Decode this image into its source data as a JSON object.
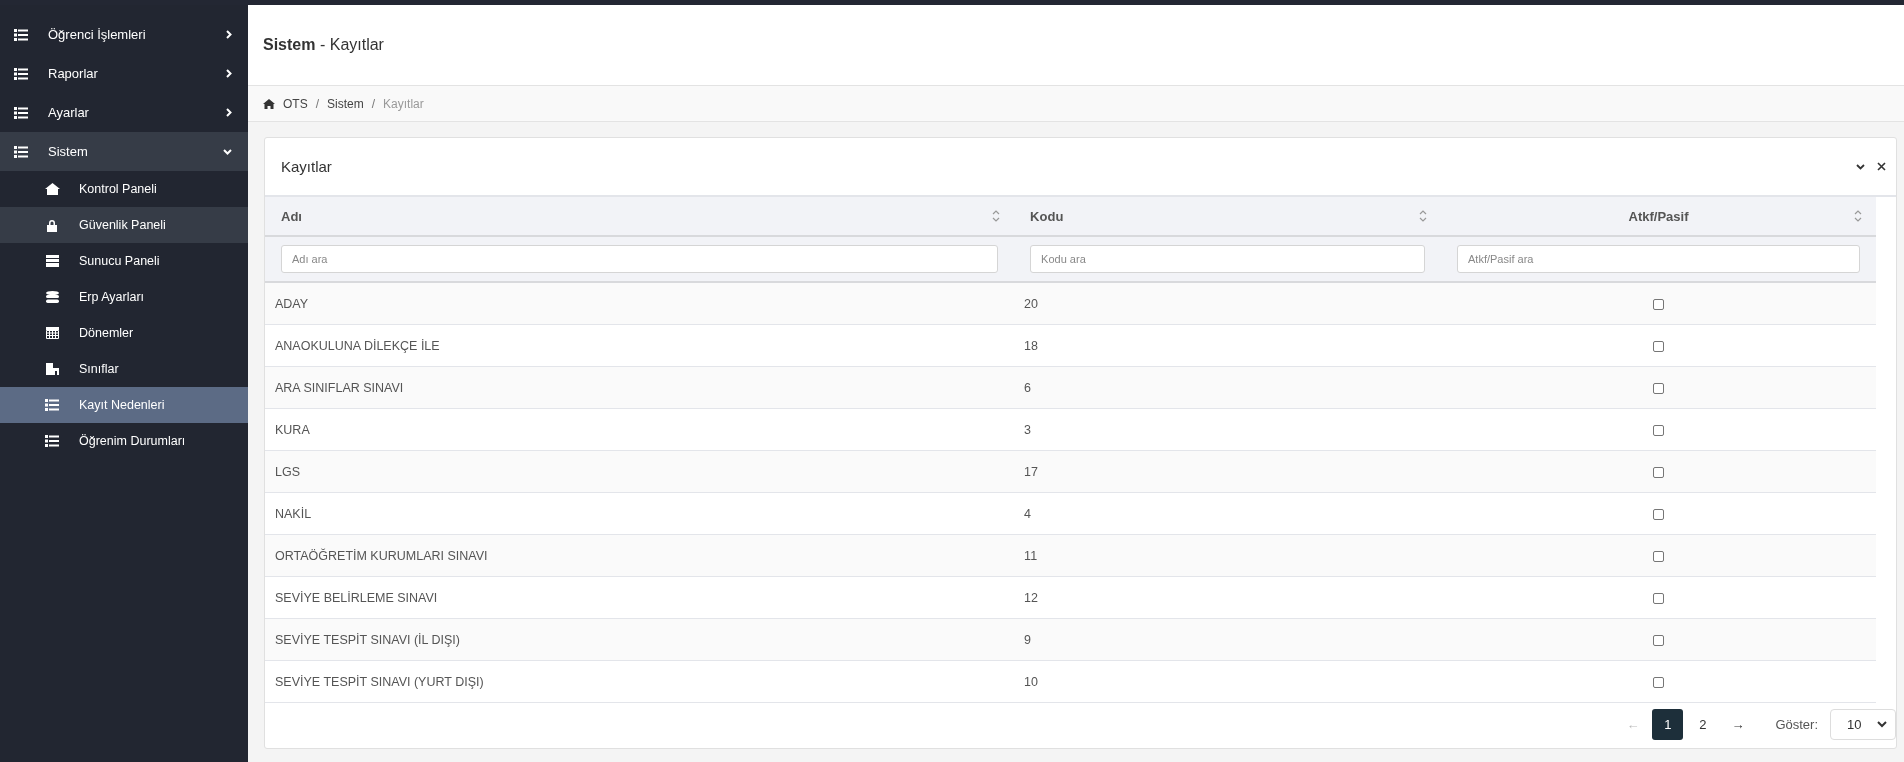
{
  "sidebar": {
    "items": [
      {
        "label": "Öğrenci İşlemleri",
        "expanded": false
      },
      {
        "label": "Raporlar",
        "expanded": false
      },
      {
        "label": "Ayarlar",
        "expanded": false
      },
      {
        "label": "Sistem",
        "expanded": true,
        "children": [
          {
            "label": "Kontrol Paneli",
            "kind": "home",
            "selected": false,
            "hovered": false
          },
          {
            "label": "Güvenlik Paneli",
            "kind": "lock",
            "selected": false,
            "hovered": true
          },
          {
            "label": "Sunucu Paneli",
            "kind": "server",
            "selected": false,
            "hovered": false
          },
          {
            "label": "Erp Ayarları",
            "kind": "database",
            "selected": false,
            "hovered": false
          },
          {
            "label": "Dönemler",
            "kind": "calendar",
            "selected": false,
            "hovered": false
          },
          {
            "label": "Sınıflar",
            "kind": "building",
            "selected": false,
            "hovered": false
          },
          {
            "label": "Kayıt Nedenleri",
            "kind": "list",
            "selected": true,
            "hovered": false
          },
          {
            "label": "Öğrenim Durumları",
            "kind": "list",
            "selected": false,
            "hovered": false
          }
        ]
      }
    ]
  },
  "header": {
    "section": "Sistem",
    "separator": "-",
    "page": "Kayıtlar"
  },
  "breadcrumb": [
    {
      "label": "OTS",
      "current": false
    },
    {
      "label": "Sistem",
      "current": false
    },
    {
      "label": "Kayıtlar",
      "current": true
    }
  ],
  "breadcrumb_separator": "/",
  "card": {
    "title": "Kayıtlar",
    "table": {
      "columns": [
        {
          "label": "Adı",
          "placeholder": "Adı ara"
        },
        {
          "label": "Kodu",
          "placeholder": "Kodu ara"
        },
        {
          "label": "Atkf/Pasif",
          "placeholder": "Atkf/Pasif ara"
        }
      ],
      "rows": [
        {
          "name": "ADAY",
          "code": "20",
          "checked": false
        },
        {
          "name": "ANAOKULUNA DİLEKÇE İLE",
          "code": "18",
          "checked": false
        },
        {
          "name": "ARA SINIFLAR SINAVI",
          "code": "6",
          "checked": false
        },
        {
          "name": "KURA",
          "code": "3",
          "checked": false
        },
        {
          "name": "LGS",
          "code": "17",
          "checked": false
        },
        {
          "name": "NAKİL",
          "code": "4",
          "checked": false
        },
        {
          "name": "ORTAÖĞRETİM KURUMLARI SINAVI",
          "code": "11",
          "checked": false
        },
        {
          "name": "SEVİYE BELİRLEME SINAVI",
          "code": "12",
          "checked": false
        },
        {
          "name": "SEVİYE TESPİT SINAVI (İL DIŞI)",
          "code": "9",
          "checked": false
        },
        {
          "name": "SEVİYE TESPİT SINAVI (YURT DIŞI)",
          "code": "10",
          "checked": false
        }
      ]
    },
    "pagination": {
      "prev": {
        "label": "←",
        "disabled": true
      },
      "pages": [
        {
          "label": "1",
          "selected": true
        },
        {
          "label": "2",
          "selected": false
        }
      ],
      "next": {
        "label": "→",
        "disabled": false
      },
      "show_label": "Göster:",
      "page_size": "10"
    }
  }
}
